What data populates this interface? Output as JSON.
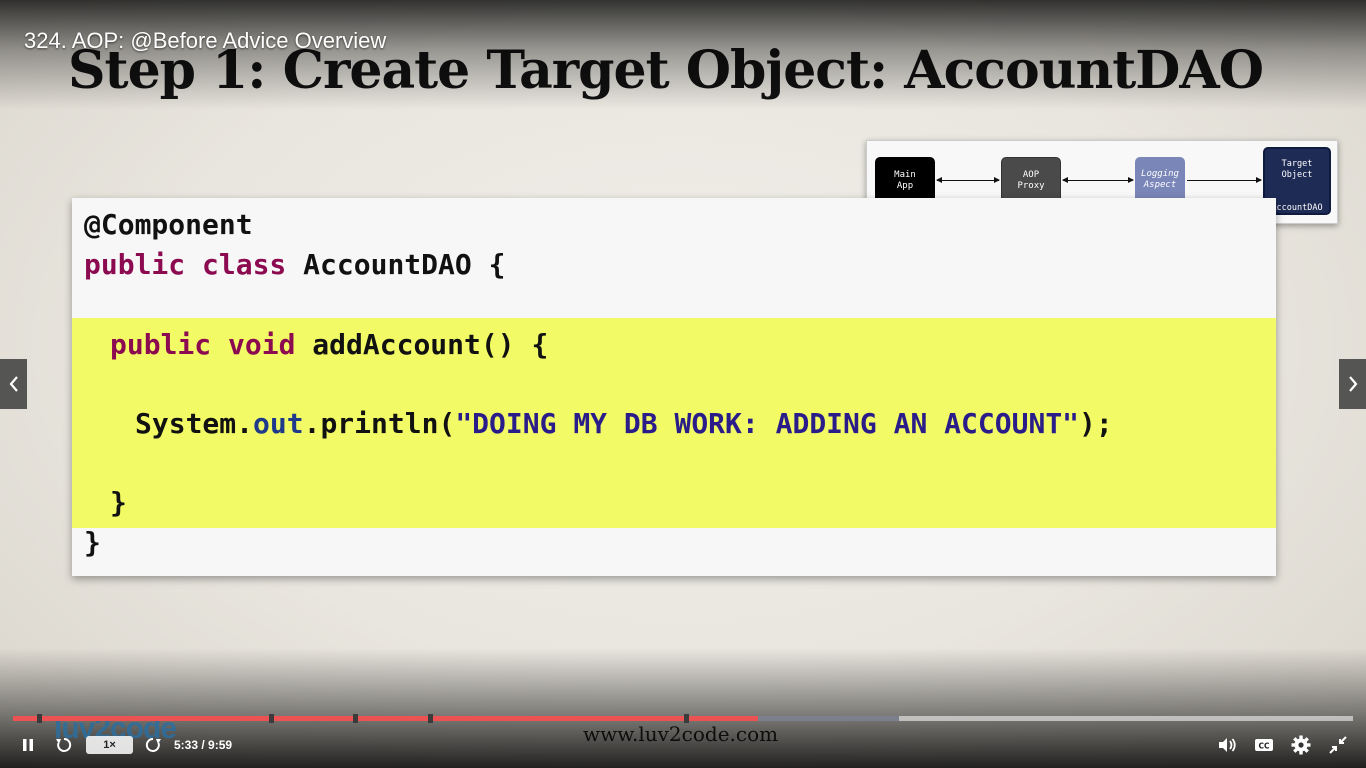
{
  "lecture": {
    "title": "324. AOP: @Before Advice Overview"
  },
  "slide": {
    "title": "Step 1: Create Target Object: AccountDAO",
    "diagram": {
      "main_app": "Main\nApp",
      "aop_proxy": "AOP\nProxy",
      "logging_aspect": "Logging\nAspect",
      "target_object": "Target\nObject",
      "target_name": "AccountDAO"
    },
    "code": {
      "line1": "@Component",
      "line2_kw": "public class",
      "line2_rest": " AccountDAO {",
      "line3_kw": "public void",
      "line3_rest": " addAccount() {",
      "line4_pre": "System.",
      "line4_field": "out",
      "line4_mid": ".println(",
      "line4_str": "\"DOING MY DB WORK: ADDING AN ACCOUNT\"",
      "line4_end": ");",
      "line5": "}",
      "line6": "}"
    },
    "footer_logo": "luv2code",
    "footer_url": "www.luv2code.com"
  },
  "player": {
    "speed": "1×",
    "current_time": "5:33",
    "duration": "9:59",
    "time_text": "5:33 / 9:59",
    "progress_fraction": 0.556,
    "buffered_fraction": 0.661,
    "chapter_fractions": [
      0.018,
      0.191,
      0.254,
      0.31,
      0.501
    ],
    "accent_color": "#ec5252",
    "prev_icon": "chevron-left-icon",
    "next_icon": "chevron-right-icon"
  }
}
